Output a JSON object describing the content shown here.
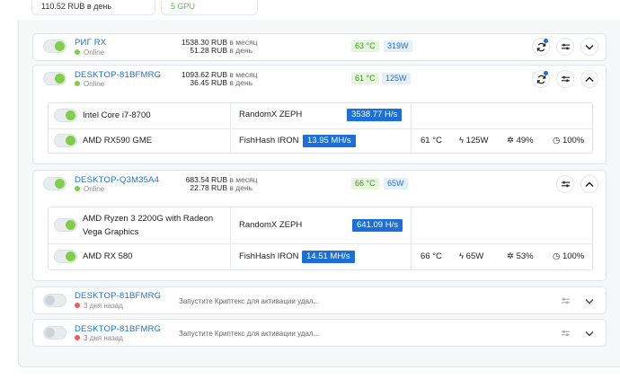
{
  "top_cards": {
    "left": "110.52 RUB в день",
    "right": "5 GPU"
  },
  "rigs": [
    {
      "name": "РИГ RX",
      "status": "Online",
      "month": "1538.30 RUB",
      "month_unit": "в месяц",
      "day": "51.28 RUB",
      "day_unit": "в день",
      "temp": "63 °C",
      "watt": "319W"
    },
    {
      "name": "DESKTOP-81BFMRG",
      "status": "Online",
      "month": "1093.62 RUB",
      "month_unit": "в месяц",
      "day": "36.45 RUB",
      "day_unit": "в день",
      "temp": "61 °C",
      "watt": "125W",
      "devices": [
        {
          "name": "Intel Core i7-8700",
          "algo": "RandomX ZEPH",
          "hashrate": "3538.77 H/s"
        },
        {
          "name": "AMD RX590 GME",
          "algo": "FishHash IRON",
          "hashrate": "13.95 MH/s",
          "temp": "61 °C",
          "power": "125W",
          "fan": "49%",
          "load": "100%"
        }
      ]
    },
    {
      "name": "DESKTOP-Q3M35A4",
      "status": "Online",
      "month": "683.54 RUB",
      "month_unit": "в месяц",
      "day": "22.78 RUB",
      "day_unit": "в день",
      "temp": "66 °C",
      "watt": "65W",
      "devices": [
        {
          "name_line1": "AMD Ryzen 3 2200G with Radeon",
          "name_line2": "Vega Graphics",
          "algo": "RandomX ZEPH",
          "hashrate": "641.09 H/s"
        },
        {
          "name": "AMD RX 580",
          "algo": "FishHash IRON",
          "hashrate": "14.51 MH/s",
          "temp": "66 °C",
          "power": "65W",
          "fan": "53%",
          "load": "100%"
        }
      ]
    },
    {
      "name": "DESKTOP-81BFMRG",
      "status": "3 дня назад",
      "message": "Запустите Криптекс для активации удал..."
    },
    {
      "name": "DESKTOP-81BFMRG",
      "status": "3 дня назад",
      "message": "Запустите Криптекс для активации удал..."
    }
  ],
  "colors": {
    "accent": "#1d6fd6",
    "online": "#7fcf46",
    "offline": "#f25b5b",
    "temp_bg": "#e6f5dc",
    "watt_bg": "#e3effa"
  }
}
